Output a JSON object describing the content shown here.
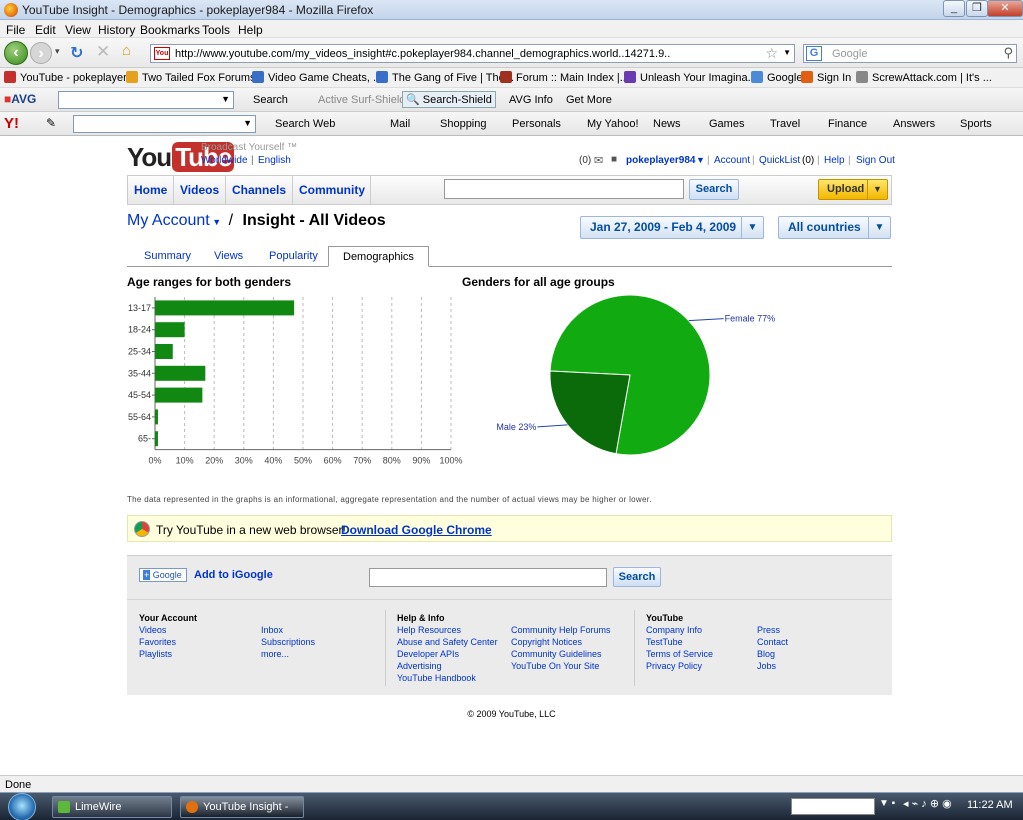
{
  "window": {
    "title": "YouTube Insight - Demographics - pokeplayer984 - Mozilla Firefox",
    "controls": [
      "_",
      "❐",
      "✕"
    ]
  },
  "menu": [
    "File",
    "Edit",
    "View",
    "History",
    "Bookmarks",
    "Tools",
    "Help"
  ],
  "nav": {
    "url": "http://www.youtube.com/my_videos_insight#c.pokeplayer984.channel_demographics.world..14271.9..",
    "search_placeholder": "Google",
    "favicon_text": "You"
  },
  "bookmarks": [
    {
      "label": "YouTube - pokeplayer...",
      "color": "#c4302b"
    },
    {
      "label": "Two Tailed Fox Forums",
      "color": "#e6a020"
    },
    {
      "label": "Video Game Cheats, ...",
      "color": "#3a6fc8"
    },
    {
      "label": "The Gang of Five | The...",
      "color": "#3a6fc8"
    },
    {
      "label": "Forum :: Main Index |...",
      "color": "#a03020"
    },
    {
      "label": "Unleash Your Imagina...",
      "color": "#6a3ab0"
    },
    {
      "label": "Google",
      "color": "#4a8ad8"
    },
    {
      "label": "Sign In",
      "color": "#e06010"
    },
    {
      "label": "ScrewAttack.com | It's ...",
      "color": "#888888"
    }
  ],
  "avg_toolbar": {
    "logo": "AVG",
    "items": [
      "Search",
      "Active Surf-Shield",
      "Search-Shield",
      "AVG Info",
      "Get More"
    ]
  },
  "yahoo_toolbar": {
    "logo": "Y!",
    "items": [
      "Search Web",
      "Mail",
      "Shopping",
      "Personals",
      "My Yahoo!",
      "News",
      "Games",
      "Travel",
      "Finance",
      "Answers",
      "Sports"
    ]
  },
  "youtube": {
    "logo_you": "You",
    "logo_tube": "Tube",
    "tagline": "Broadcast Yourself ™",
    "locale_worldwide": "Worldwide",
    "locale_english": "English",
    "inbox_count": "(0)",
    "username": "pokeplayer984",
    "account_link": "Account",
    "quicklist": "QuickList",
    "quicklist_count": "(0)",
    "help": "Help",
    "signout": "Sign Out",
    "tabs": [
      "Home",
      "Videos",
      "Channels",
      "Community"
    ],
    "search_button": "Search",
    "upload_button": "Upload",
    "breadcrumb_account": "My Account",
    "breadcrumb_sep": "/",
    "breadcrumb_page": "Insight - All Videos",
    "date_range": "Jan 27, 2009 - Feb 4, 2009",
    "country_filter": "All countries",
    "insight_tabs": [
      "Summary",
      "Views",
      "Popularity",
      "Demographics"
    ],
    "active_tab": "Demographics",
    "footnote": "The data represented in the graphs is an informational, aggregate representation and the number of actual views may be higher or lower.",
    "chrome_promo_text": "Try YouTube in a new web browser!",
    "chrome_promo_link": "Download Google Chrome",
    "igoogle_logo": "Google",
    "igoogle_label": "Add to iGoogle",
    "footer_search_button": "Search",
    "footer": {
      "your_account": {
        "title": "Your Account",
        "links": [
          "Videos",
          "Favorites",
          "Playlists",
          "Inbox",
          "Subscriptions",
          "more..."
        ]
      },
      "help_info": {
        "title": "Help & Info",
        "links": [
          "Help Resources",
          "Abuse and Safety Center",
          "Developer APIs",
          "Advertising",
          "YouTube Handbook",
          "Community Help Forums",
          "Copyright Notices",
          "Community Guidelines",
          "YouTube On Your Site"
        ]
      },
      "youtube": {
        "title": "YouTube",
        "links": [
          "Company Info",
          "TestTube",
          "Terms of Service",
          "Privacy Policy",
          "Press",
          "Contact",
          "Blog",
          "Jobs"
        ]
      }
    },
    "copyright": "© 2009 YouTube, LLC"
  },
  "status": "Done",
  "taskbar": {
    "items": [
      "LimeWire",
      "YouTube Insight - D..."
    ],
    "clock": "11:22 AM"
  },
  "chart_data": [
    {
      "type": "bar",
      "orientation": "horizontal",
      "title": "Age ranges for both genders",
      "categories": [
        "13-17",
        "18-24",
        "25-34",
        "35-44",
        "45-54",
        "55-64",
        "65-"
      ],
      "values": [
        47,
        10,
        6,
        17,
        16,
        1,
        1
      ],
      "xlim": [
        0,
        100
      ],
      "xticks": [
        "0%",
        "10%",
        "20%",
        "30%",
        "40%",
        "50%",
        "60%",
        "70%",
        "80%",
        "90%",
        "100%"
      ],
      "grid": true,
      "color": "#118811"
    },
    {
      "type": "pie",
      "title": "Genders for all age groups",
      "slices": [
        {
          "label": "Female 77%",
          "value": 77,
          "color": "#11aa11"
        },
        {
          "label": "Male 23%",
          "value": 23,
          "color": "#0b6b0b"
        }
      ]
    }
  ]
}
